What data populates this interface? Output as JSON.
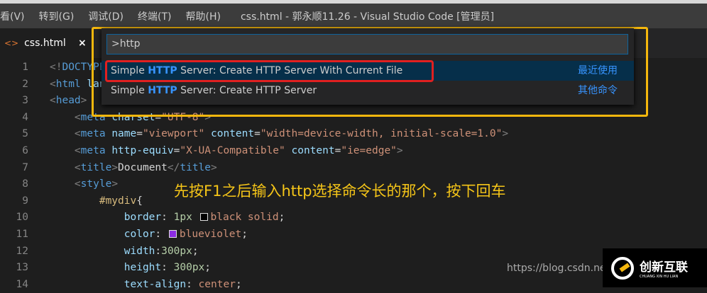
{
  "menu": [
    "看(V)",
    "转到(G)",
    "调试(D)",
    "终端(T)",
    "帮助(H)"
  ],
  "window_title": "css.html - 郭永顺11.26 - Visual Studio Code [管理员]",
  "tab": {
    "name": "css.html",
    "close": "×"
  },
  "palette": {
    "input": ">http",
    "items": [
      {
        "pre": "Simple ",
        "hl": "HTTP",
        "post": " Server: Create HTTP Server With Current File",
        "right": "最近使用"
      },
      {
        "pre": "Simple ",
        "hl": "HTTP",
        "post": " Server: Create HTTP Server",
        "right": "其他命令"
      }
    ]
  },
  "code": [
    [
      [
        "p",
        "<!"
      ],
      [
        "t",
        "DOCTYPE"
      ]
    ],
    [
      [
        "p",
        "<"
      ],
      [
        "t",
        "html"
      ],
      [
        "w",
        " "
      ],
      [
        "a",
        "lang"
      ]
    ],
    [
      [
        "p",
        "<"
      ],
      [
        "t",
        "head"
      ],
      [
        "p",
        ">"
      ]
    ],
    [
      [
        "w",
        "    "
      ],
      [
        "p",
        "<"
      ],
      [
        "t",
        "meta"
      ],
      [
        "w",
        " "
      ],
      [
        "a",
        "charset"
      ],
      [
        "w",
        "="
      ],
      [
        "s",
        "\"UTF-8\""
      ],
      [
        "p",
        ">"
      ]
    ],
    [
      [
        "w",
        "    "
      ],
      [
        "p",
        "<"
      ],
      [
        "t",
        "meta"
      ],
      [
        "w",
        " "
      ],
      [
        "a",
        "name"
      ],
      [
        "w",
        "="
      ],
      [
        "s",
        "\"viewport\""
      ],
      [
        "w",
        " "
      ],
      [
        "a",
        "content"
      ],
      [
        "w",
        "="
      ],
      [
        "s",
        "\"width=device-width, initial-scale=1.0\""
      ],
      [
        "p",
        ">"
      ]
    ],
    [
      [
        "w",
        "    "
      ],
      [
        "p",
        "<"
      ],
      [
        "t",
        "meta"
      ],
      [
        "w",
        " "
      ],
      [
        "a",
        "http-equiv"
      ],
      [
        "w",
        "="
      ],
      [
        "s",
        "\"X-UA-Compatible\""
      ],
      [
        "w",
        " "
      ],
      [
        "a",
        "content"
      ],
      [
        "w",
        "="
      ],
      [
        "s",
        "\"ie=edge\""
      ],
      [
        "p",
        ">"
      ]
    ],
    [
      [
        "w",
        "    "
      ],
      [
        "p",
        "<"
      ],
      [
        "t",
        "title"
      ],
      [
        "p",
        ">"
      ],
      [
        "w",
        "Document"
      ],
      [
        "p",
        "</"
      ],
      [
        "t",
        "title"
      ],
      [
        "p",
        ">"
      ]
    ],
    [
      [
        "w",
        "    "
      ],
      [
        "p",
        "<"
      ],
      [
        "t",
        "style"
      ],
      [
        "p",
        ">"
      ]
    ],
    [
      [
        "w",
        "        "
      ],
      [
        "sel",
        "#mydiv"
      ],
      [
        "w",
        "{"
      ]
    ],
    [
      [
        "w",
        "            "
      ],
      [
        "a",
        "border"
      ],
      [
        "w",
        ": "
      ],
      [
        "n",
        "1px "
      ],
      [
        "sw",
        "#000000"
      ],
      [
        "s",
        "black solid"
      ],
      [
        "w",
        ";"
      ]
    ],
    [
      [
        "w",
        "            "
      ],
      [
        "a",
        "color"
      ],
      [
        "w",
        ": "
      ],
      [
        "sw",
        "#8a2be2"
      ],
      [
        "s",
        "blueviolet"
      ],
      [
        "w",
        ";"
      ]
    ],
    [
      [
        "w",
        "            "
      ],
      [
        "a",
        "width"
      ],
      [
        "w",
        ":"
      ],
      [
        "n",
        "300px"
      ],
      [
        "w",
        ";"
      ]
    ],
    [
      [
        "w",
        "            "
      ],
      [
        "a",
        "height"
      ],
      [
        "w",
        ": "
      ],
      [
        "n",
        "300px"
      ],
      [
        "w",
        ";"
      ]
    ],
    [
      [
        "w",
        "            "
      ],
      [
        "a",
        "text-align"
      ],
      [
        "w",
        ": "
      ],
      [
        "s",
        "center"
      ],
      [
        "w",
        ";"
      ]
    ]
  ],
  "annotation": "先按F1之后输入http选择命令长的那个，按下回车",
  "watermark": "https://blog.csdn.ne",
  "logo": {
    "cn": "创新互联",
    "en": "CHUANG XIN HU LIAN"
  }
}
